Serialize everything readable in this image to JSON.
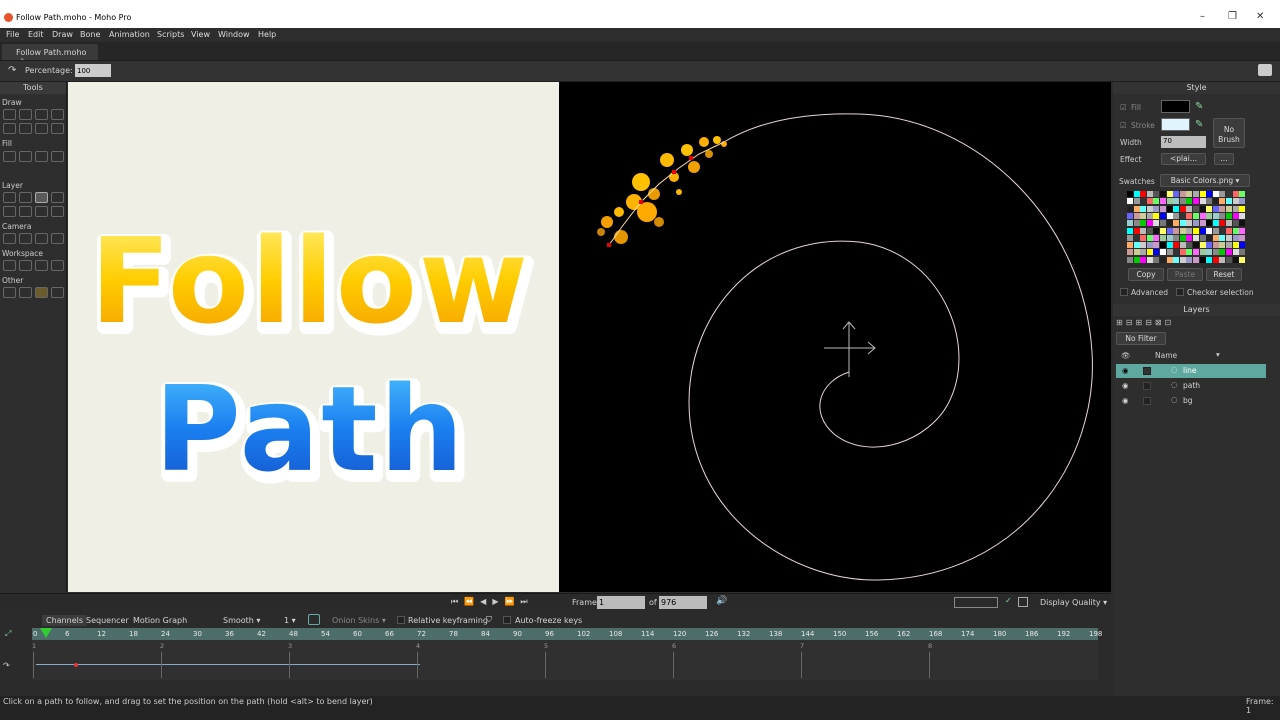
{
  "window": {
    "title": "Follow Path.moho - Moho Pro",
    "min": "–",
    "max": "❐",
    "close": "✕"
  },
  "menu": [
    "File",
    "Edit",
    "Draw",
    "Bone",
    "Animation",
    "Scripts",
    "View",
    "Window",
    "Help"
  ],
  "tab": {
    "label": "Follow Path.moho"
  },
  "options": {
    "percentage_label": "Percentage:",
    "percentage_value": "100"
  },
  "tools": {
    "title": "Tools",
    "sections": [
      "Draw",
      "Fill",
      "Layer",
      "Camera",
      "Workspace",
      "Other"
    ]
  },
  "canvas": {
    "title_line1": "Follow",
    "title_line2": "Path"
  },
  "style": {
    "title": "Style",
    "fill_label": "Fill",
    "stroke_label": "Stroke",
    "width_label": "Width",
    "width_value": "70",
    "effect_label": "Effect",
    "effect_value": "<plai...",
    "effect_more": "...",
    "no_brush": "No Brush",
    "swatches_label": "Swatches",
    "swatches_value": "Basic Colors.png",
    "copy": "Copy",
    "paste": "Paste",
    "reset": "Reset",
    "advanced": "Advanced",
    "checker": "Checker selection",
    "fill_color": "#000000",
    "stroke_color": "#dff4ff"
  },
  "layers": {
    "title": "Layers",
    "filter": "No Filter",
    "name_col": "Name",
    "items": [
      {
        "name": "line",
        "selected": true
      },
      {
        "name": "path",
        "selected": false
      },
      {
        "name": "bg",
        "selected": false
      }
    ]
  },
  "playback": {
    "frame_label": "Frame",
    "frame_value": "1",
    "of_label": "of",
    "total_value": "976",
    "display_quality": "Display Quality"
  },
  "timeline": {
    "tabs": [
      "Channels",
      "Sequencer",
      "Motion Graph"
    ],
    "interp": "Smooth",
    "interp_num": "1",
    "onion": "Onion Skins",
    "relative": "Relative keyframing",
    "autofreeze": "Auto-freeze keys",
    "ruler": [
      "0",
      "6",
      "12",
      "18",
      "24",
      "30",
      "36",
      "42",
      "48",
      "54",
      "60",
      "66",
      "72",
      "78",
      "84",
      "90",
      "96",
      "102",
      "108",
      "114",
      "120",
      "126",
      "132",
      "138",
      "144",
      "150",
      "156",
      "162",
      "168",
      "174",
      "180",
      "186",
      "192",
      "198"
    ],
    "track_marks": [
      "1",
      "2",
      "3",
      "4",
      "5",
      "6",
      "7",
      "8"
    ]
  },
  "status": {
    "message": "Click on a path to follow, and drag to set the position on the path (hold <alt> to bend layer)",
    "frame": "Frame: 1"
  }
}
